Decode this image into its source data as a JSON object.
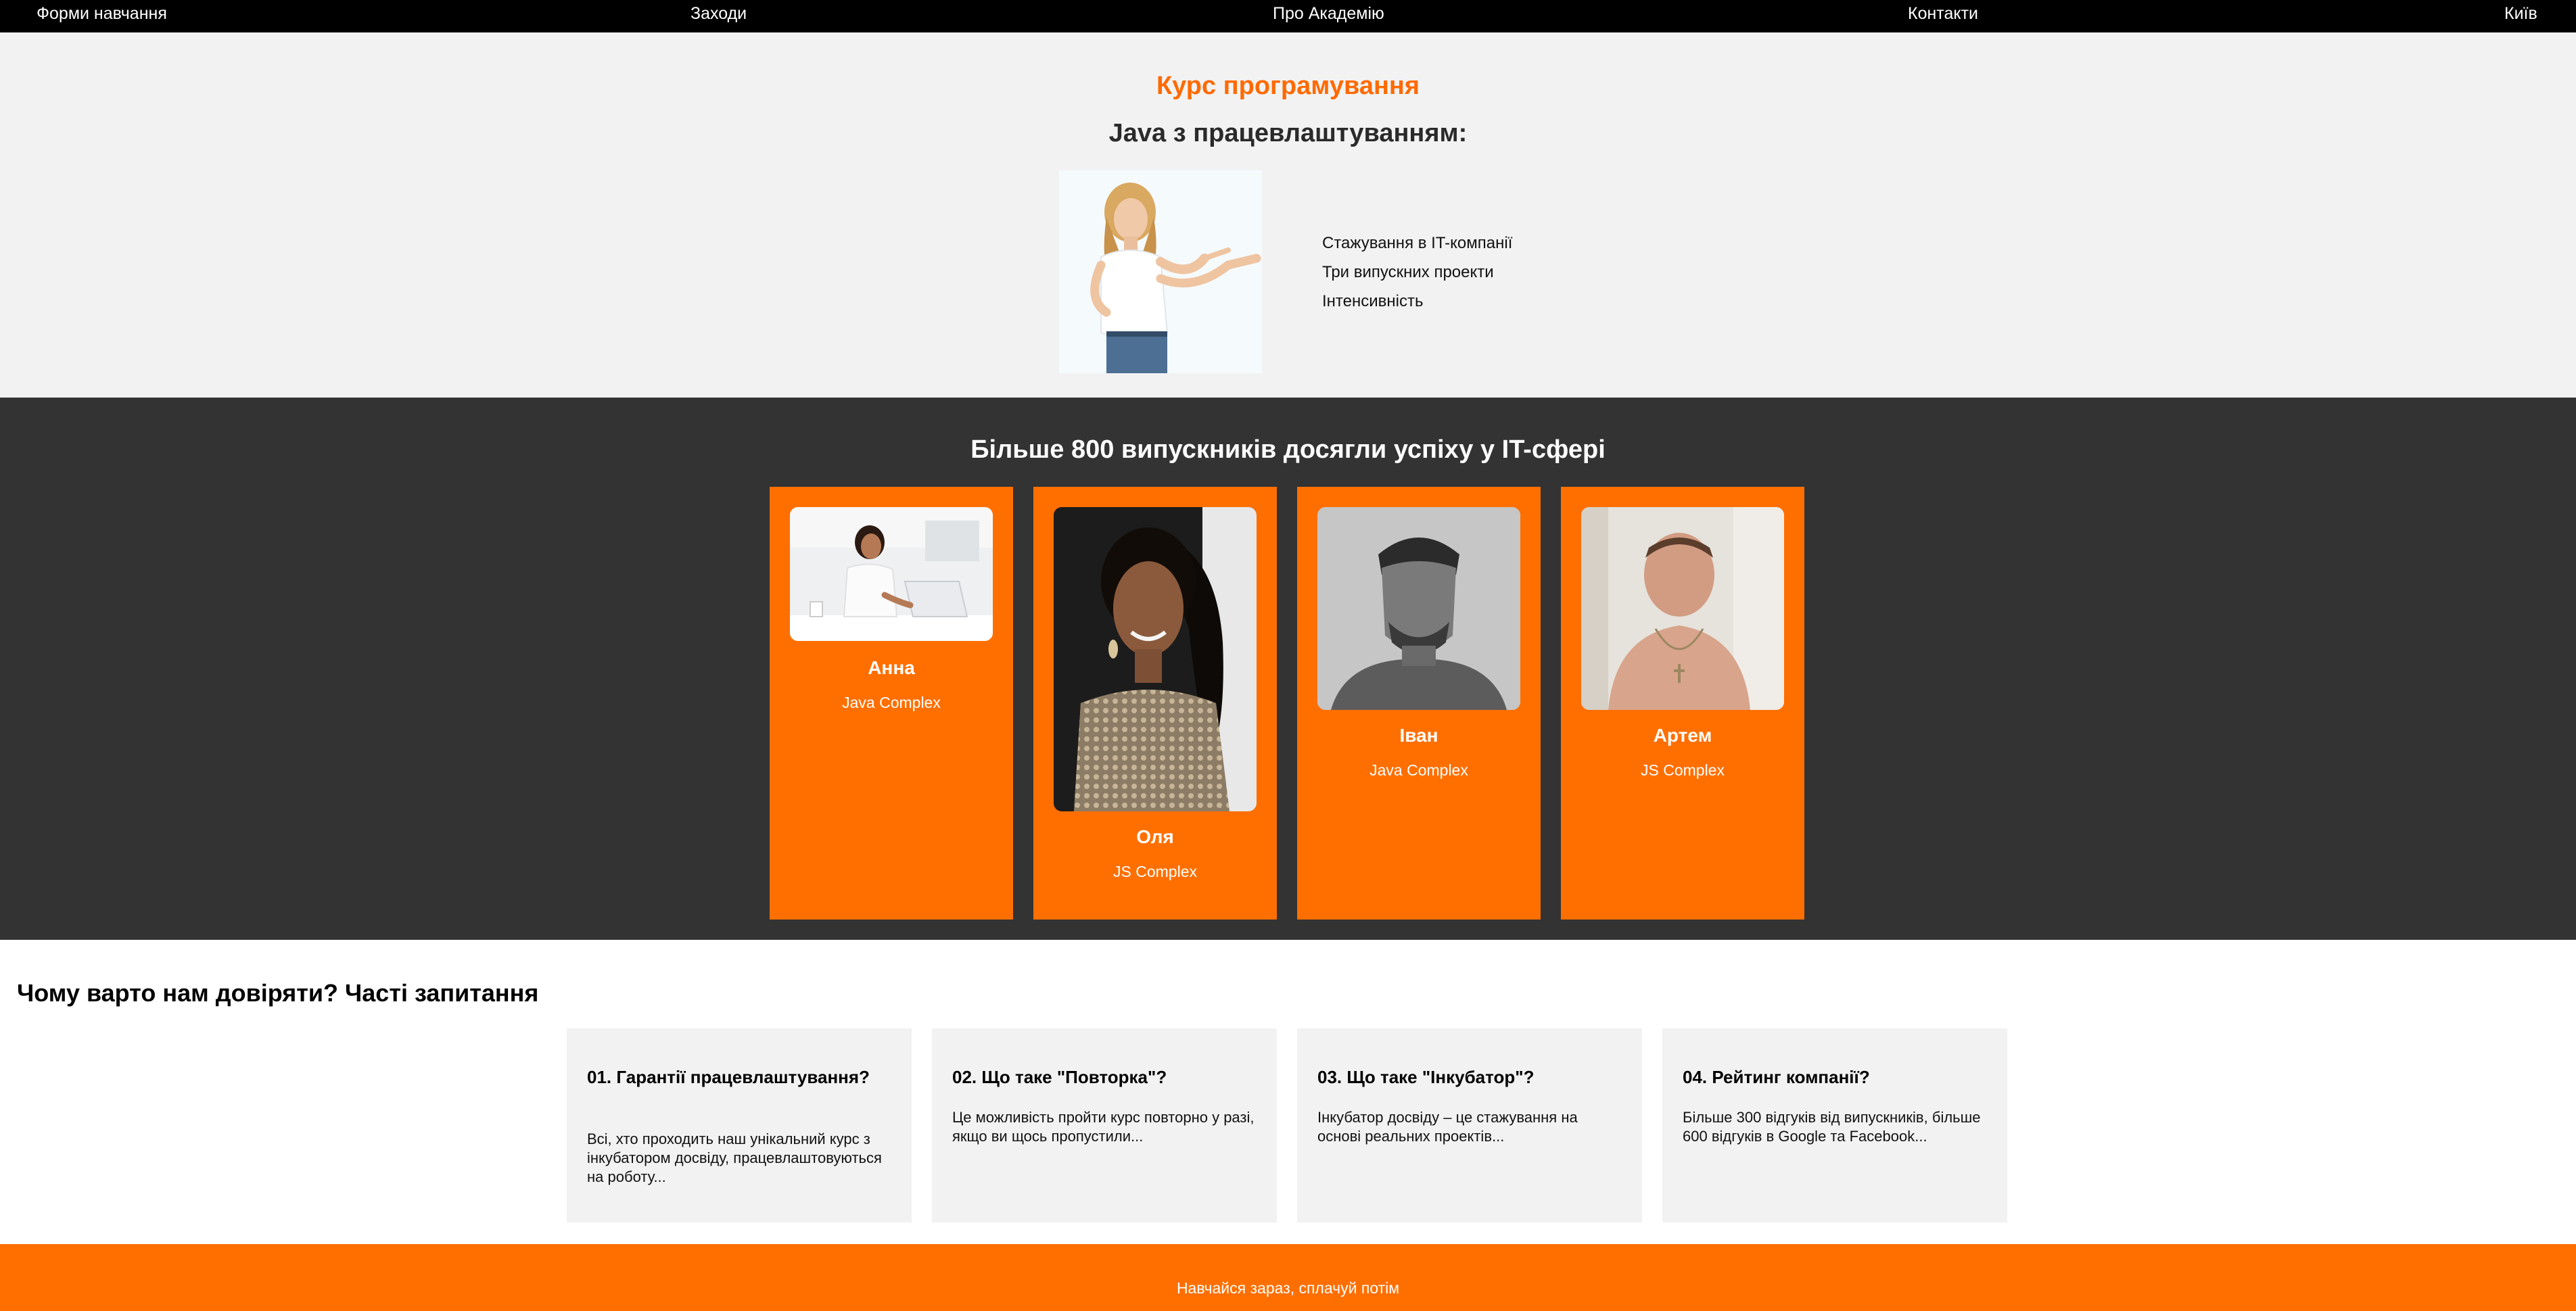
{
  "nav": {
    "items": [
      {
        "label": "Форми навчання"
      },
      {
        "label": "Заходи"
      },
      {
        "label": "Про Академію"
      },
      {
        "label": "Контакти"
      },
      {
        "label": "Київ"
      }
    ]
  },
  "hero": {
    "title": "Курс програмування",
    "subtitle": "Java з працевлаштуванням:",
    "features": [
      "Стажування в IT-компанії",
      "Три випускних проекти",
      "Інтенсивність"
    ]
  },
  "graduates": {
    "title": "Більше 800 випускників досягли успіху у IT-сфері",
    "cards": [
      {
        "name": "Анна",
        "course": "Java Complex"
      },
      {
        "name": "Оля",
        "course": "JS Complex"
      },
      {
        "name": "Іван",
        "course": "Java Complex"
      },
      {
        "name": "Артем",
        "course": "JS Complex"
      }
    ]
  },
  "faq": {
    "title": "Чому варто нам довіряти? Часті запитання",
    "items": [
      {
        "question": "01. Гарантії працевлаштування?",
        "answer": "Всі, хто проходить наш унікальний курс з інкубатором досвіду, працевлаштовуються на роботу..."
      },
      {
        "question": "02. Що таке \"Повторка\"?",
        "answer": "Це можливість пройти курс повторно у разі, якщо ви щось пропустили..."
      },
      {
        "question": "03. Що таке \"Інкубатор\"?",
        "answer": "Інкубатор досвіду – це стажування на основі реальних проектів..."
      },
      {
        "question": "04. Рейтинг компанії?",
        "answer": "Більше 300 відгуків від випускників, більше 600 відгуків в Google та Facebook..."
      }
    ]
  },
  "footer": {
    "cta": "Навчайся зараз, сплачуй потім"
  },
  "colors": {
    "accent": "#ff6f00",
    "dark_section": "#333333",
    "light_section": "#f2f2f2",
    "nav": "#000000"
  }
}
